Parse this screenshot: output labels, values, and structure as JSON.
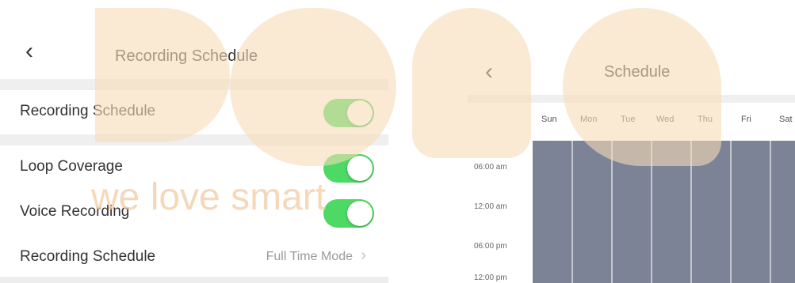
{
  "settings_screen": {
    "back_glyph": "‹",
    "title": "Recording Schedule",
    "rows": [
      {
        "label": "Recording Schedule",
        "toggle_on": true
      },
      {
        "label": "Loop Coverage",
        "toggle_on": true
      },
      {
        "label": "Voice Recording",
        "toggle_on": true
      },
      {
        "label": "Recording Schedule",
        "value": "Full Time Mode",
        "chevron": "›"
      }
    ],
    "toggle_color": "#4cd964"
  },
  "schedule_screen": {
    "back_glyph": "‹",
    "title": "Schedule",
    "days": [
      "Sun",
      "Mon",
      "Tue",
      "Wed",
      "Thu",
      "Fri",
      "Sat"
    ],
    "times": [
      "06:00 am",
      "12:00 am",
      "06:00 pm",
      "12:00 pm"
    ],
    "grid_color": "#7c8396"
  },
  "watermark": {
    "text": "we love smart",
    "color": "#f6dcb8"
  }
}
